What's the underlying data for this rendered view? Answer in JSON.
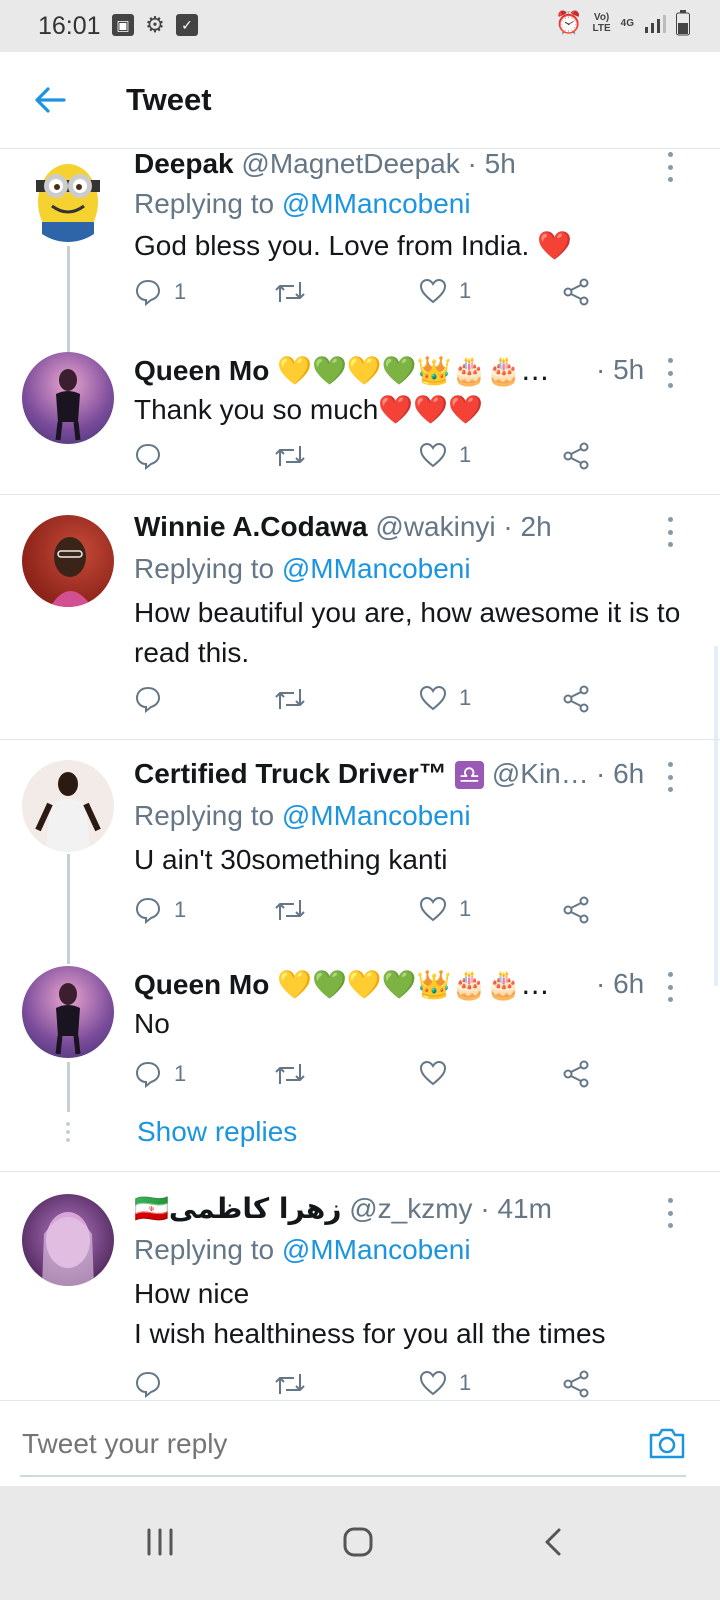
{
  "status_bar": {
    "time": "16:01",
    "network_top": "Vo)",
    "network_bottom": "LTE",
    "network_type": "4G"
  },
  "app_bar": {
    "title": "Tweet"
  },
  "tweets": [
    {
      "name": "Deepak",
      "handle": "@MagnetDeepak",
      "time": "· 5h",
      "replying_prefix": "Replying to ",
      "replying_to": "@MMancobeni",
      "text": "God bless you. Love from India. ❤️",
      "replies": "1",
      "likes": "1"
    },
    {
      "name": "Queen Mo",
      "badges": "💛💚💛💚👑🎂🎂…",
      "time": "· 5h",
      "text": "Thank you so much❤️❤️❤️",
      "replies": "",
      "likes": "1"
    },
    {
      "name": "Winnie A.Codawa",
      "handle": "@wakinyi",
      "time": "· 2h",
      "replying_prefix": "Replying to ",
      "replying_to": "@MMancobeni",
      "text": "How beautiful you are, how awesome it is to read this.",
      "replies": "",
      "likes": "1"
    },
    {
      "name": "Certified Truck Driver™",
      "badges": "♎",
      "handle": "@Kin…",
      "time": "· 6h",
      "replying_prefix": "Replying to ",
      "replying_to": "@MMancobeni",
      "text": "U ain't 30something kanti",
      "replies": "1",
      "likes": "1"
    },
    {
      "name": "Queen Mo",
      "badges": "💛💚💛💚👑🎂🎂…",
      "time": "· 6h",
      "text": "No",
      "replies": "1",
      "likes": ""
    },
    {
      "name": "زهرا کاظمی",
      "flag": "🇮🇷",
      "handle": "@z_kzmy",
      "time": "· 41m",
      "replying_prefix": "Replying to ",
      "replying_to": "@MMancobeni",
      "text_line1": "How nice",
      "text_line2": "I wish healthiness for you all the times",
      "replies": "",
      "likes": "1"
    }
  ],
  "show_replies": "Show replies",
  "reply_bar": {
    "placeholder": "Tweet your reply"
  },
  "colors": {
    "accent": "#1b95e0",
    "muted": "#657786"
  },
  "icons": [
    "reply-icon",
    "retweet-icon",
    "like-icon",
    "share-icon",
    "camera-icon",
    "back-arrow-icon"
  ]
}
